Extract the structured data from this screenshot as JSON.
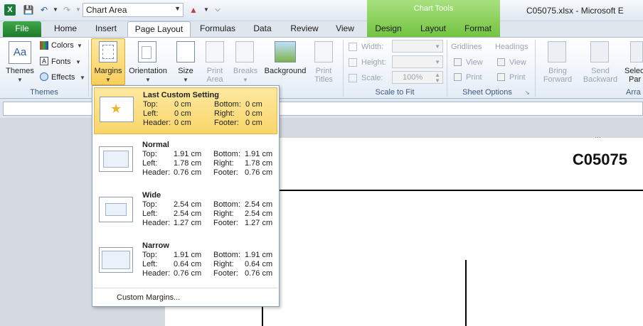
{
  "titlebar": {
    "namebox_value": "Chart Area",
    "chart_tools_label": "Chart Tools",
    "window_title": "C05075.xlsx - Microsoft E"
  },
  "tabs": {
    "file": "File",
    "home": "Home",
    "insert": "Insert",
    "page_layout": "Page Layout",
    "formulas": "Formulas",
    "data": "Data",
    "review": "Review",
    "view": "View",
    "design": "Design",
    "layout": "Layout",
    "format": "Format"
  },
  "ribbon": {
    "themes": {
      "themes_label": "Themes",
      "colors_label": "Colors",
      "fonts_label": "Fonts",
      "effects_label": "Effects",
      "group_label": "Themes"
    },
    "page_setup": {
      "margins_label": "Margins",
      "orientation_label": "Orientation",
      "size_label": "Size",
      "print_area_label_1": "Print",
      "print_area_label_2": "Area",
      "breaks_label": "Breaks",
      "background_label": "Background",
      "print_titles_label_1": "Print",
      "print_titles_label_2": "Titles"
    },
    "scale_to_fit": {
      "width_label": "Width:",
      "height_label": "Height:",
      "scale_label": "Scale:",
      "scale_value": "100%",
      "group_label": "Scale to Fit"
    },
    "sheet_options": {
      "gridlines_label": "Gridlines",
      "headings_label": "Headings",
      "view_label": "View",
      "print_label": "Print",
      "group_label": "Sheet Options"
    },
    "arrange": {
      "bring_forward_1": "Bring",
      "bring_forward_2": "Forward",
      "send_backward_1": "Send",
      "send_backward_2": "Backward",
      "selection_1": "Selec",
      "selection_2": "Par",
      "group_label": "Arra"
    }
  },
  "sheet": {
    "name": "C05075"
  },
  "margins_menu": {
    "options": [
      {
        "title": "Last Custom Setting",
        "top_label": "Top:",
        "top": "0 cm",
        "bottom_label": "Bottom:",
        "bottom": "0 cm",
        "left_label": "Left:",
        "left": "0 cm",
        "right_label": "Right:",
        "right": "0 cm",
        "header_label": "Header:",
        "header": "0 cm",
        "footer_label": "Footer:",
        "footer": "0 cm"
      },
      {
        "title": "Normal",
        "top_label": "Top:",
        "top": "1.91 cm",
        "bottom_label": "Bottom:",
        "bottom": "1.91 cm",
        "left_label": "Left:",
        "left": "1.78 cm",
        "right_label": "Right:",
        "right": "1.78 cm",
        "header_label": "Header:",
        "header": "0.76 cm",
        "footer_label": "Footer:",
        "footer": "0.76 cm"
      },
      {
        "title": "Wide",
        "top_label": "Top:",
        "top": "2.54 cm",
        "bottom_label": "Bottom:",
        "bottom": "2.54 cm",
        "left_label": "Left:",
        "left": "2.54 cm",
        "right_label": "Right:",
        "right": "2.54 cm",
        "header_label": "Header:",
        "header": "1.27 cm",
        "footer_label": "Footer:",
        "footer": "1.27 cm"
      },
      {
        "title": "Narrow",
        "top_label": "Top:",
        "top": "1.91 cm",
        "bottom_label": "Bottom:",
        "bottom": "1.91 cm",
        "left_label": "Left:",
        "left": "0.64 cm",
        "right_label": "Right:",
        "right": "0.64 cm",
        "header_label": "Header:",
        "header": "0.76 cm",
        "footer_label": "Footer:",
        "footer": "0.76 cm"
      }
    ],
    "custom_margins_label": "Custom Margins..."
  }
}
